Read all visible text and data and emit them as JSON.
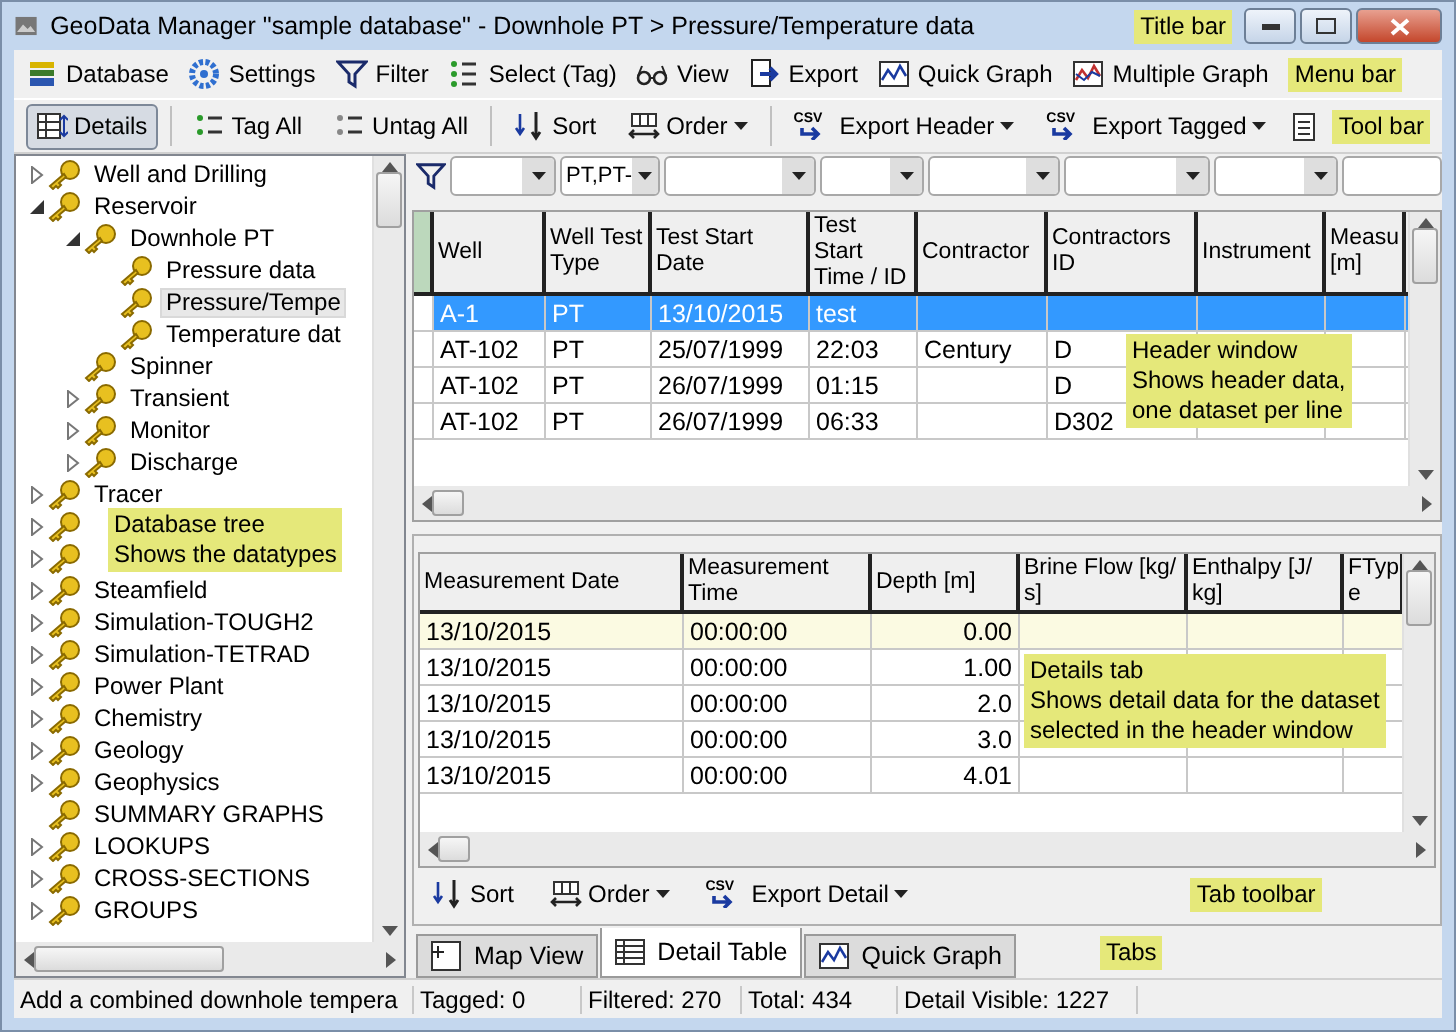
{
  "window": {
    "title": "GeoData Manager  \"sample database\" - Downhole PT > Pressure/Temperature data",
    "note": "Title bar"
  },
  "menu_bar": {
    "items": [
      {
        "label": "Database"
      },
      {
        "label": "Settings"
      },
      {
        "label": "Filter"
      },
      {
        "label": "Select (Tag)"
      },
      {
        "label": "View"
      },
      {
        "label": "Export"
      },
      {
        "label": "Quick Graph"
      },
      {
        "label": "Multiple Graph"
      }
    ],
    "note": "Menu bar"
  },
  "tool_bar": {
    "items": [
      {
        "label": "Details",
        "kind": "toggle",
        "selected": true
      },
      {
        "label": "Tag All",
        "kind": "button"
      },
      {
        "label": "Untag All",
        "kind": "button"
      },
      {
        "label": "Sort",
        "kind": "button"
      },
      {
        "label": "Order",
        "kind": "dropdown"
      },
      {
        "label": "Export Header",
        "kind": "dropdown",
        "icon_text": "CSV"
      },
      {
        "label": "Export Tagged",
        "kind": "dropdown",
        "icon_text": "CSV"
      },
      {
        "kind": "icon"
      }
    ],
    "note": "Tool bar"
  },
  "tree": {
    "note": [
      "Database tree",
      "Shows the datatypes"
    ],
    "items": [
      {
        "label": "Well and Drilling",
        "expanded": false
      },
      {
        "label": "Reservoir",
        "expanded": true,
        "children": [
          {
            "label": "Downhole PT",
            "expanded": true,
            "children": [
              {
                "label": "Pressure data",
                "selected": false
              },
              {
                "label": "Pressure/Tempe",
                "selected": true
              },
              {
                "label": "Temperature dat",
                "selected": false
              }
            ]
          },
          {
            "label": "Spinner"
          },
          {
            "label": "Transient",
            "expanded": false
          },
          {
            "label": "Monitor",
            "expanded": false
          },
          {
            "label": "Discharge",
            "expanded": false
          }
        ]
      },
      {
        "label": "Tracer",
        "expanded": false
      },
      {
        "expanded": false
      },
      {
        "expanded": false
      },
      {
        "label": "Steamfield",
        "expanded": false
      },
      {
        "label": "Simulation-TOUGH2",
        "expanded": false
      },
      {
        "label": "Simulation-TETRAD",
        "expanded": false
      },
      {
        "label": "Power Plant",
        "expanded": false
      },
      {
        "label": "Chemistry",
        "expanded": false
      },
      {
        "label": "Geology",
        "expanded": false
      },
      {
        "label": "Geophysics",
        "expanded": false
      },
      {
        "label": "SUMMARY GRAPHS"
      },
      {
        "label": "LOOKUPS",
        "expanded": false
      },
      {
        "label": "CROSS-SECTIONS",
        "expanded": false
      },
      {
        "label": "GROUPS",
        "expanded": false
      }
    ]
  },
  "filters": [
    {
      "kind": "dropdown"
    },
    {
      "kind": "dropdown",
      "value": "PT,PT-"
    },
    {
      "kind": "dropdown"
    },
    {
      "kind": "dropdown"
    },
    {
      "kind": "dropdown"
    },
    {
      "kind": "dropdown"
    },
    {
      "kind": "dropdown"
    },
    {
      "kind": "field"
    }
  ],
  "header_table": {
    "note": [
      "Header window",
      "Shows header data,",
      "one dataset per line"
    ],
    "columns": [
      "Well",
      "Well Test\nType",
      "Test Start Date",
      "Test Start\nTime / ID",
      "Contractor",
      "Contractors\nID",
      "Instrument",
      "Measu\n[m]"
    ],
    "rows": [
      {
        "selected": true,
        "cells": [
          "A-1",
          "PT",
          "13/10/2015",
          "test",
          "",
          "",
          "",
          ""
        ]
      },
      {
        "selected": false,
        "cells": [
          "AT-102",
          "PT",
          "25/07/1999",
          "22:03",
          "Century",
          "D",
          "",
          ""
        ]
      },
      {
        "selected": false,
        "cells": [
          "AT-102",
          "PT",
          "26/07/1999",
          "01:15",
          "",
          "D",
          "",
          ""
        ]
      },
      {
        "selected": false,
        "cells": [
          "AT-102",
          "PT",
          "26/07/1999",
          "06:33",
          "",
          "D302",
          "",
          ""
        ]
      }
    ]
  },
  "detail_table": {
    "note": [
      "Details tab",
      "Shows detail data for the dataset",
      "selected in the header window"
    ],
    "columns": [
      "Measurement Date",
      "Measurement\nTime",
      "Depth [m]",
      "Brine Flow [kg/\ns]",
      "Enthalpy [J/\nkg]",
      "FTyp\ne"
    ],
    "rows": [
      {
        "selected": true,
        "cells": [
          "13/10/2015",
          "00:00:00",
          "0.00",
          "",
          "",
          ""
        ]
      },
      {
        "selected": false,
        "cells": [
          "13/10/2015",
          "00:00:00",
          "1.00",
          "",
          "",
          ""
        ]
      },
      {
        "selected": false,
        "cells": [
          "13/10/2015",
          "00:00:00",
          "2.0",
          "",
          "",
          ""
        ]
      },
      {
        "selected": false,
        "cells": [
          "13/10/2015",
          "00:00:00",
          "3.0",
          "",
          "",
          ""
        ]
      },
      {
        "selected": false,
        "cells": [
          "13/10/2015",
          "00:00:00",
          "4.01",
          "",
          "",
          ""
        ]
      }
    ]
  },
  "tab_toolbar": {
    "items": [
      {
        "label": "Sort",
        "kind": "button"
      },
      {
        "label": "Order",
        "kind": "dropdown"
      },
      {
        "label": "Export Detail",
        "kind": "dropdown",
        "icon_text": "CSV"
      }
    ],
    "note": "Tab toolbar"
  },
  "tabs": {
    "items": [
      {
        "label": "Map View",
        "selected": false
      },
      {
        "label": "Detail Table",
        "selected": true
      },
      {
        "label": "Quick Graph",
        "selected": false
      }
    ],
    "note": "Tabs"
  },
  "status_bar": [
    "Add a combined downhole tempera",
    "Tagged: 0",
    "Filtered: 270",
    "Total: 434",
    "Detail Visible: 1227"
  ]
}
